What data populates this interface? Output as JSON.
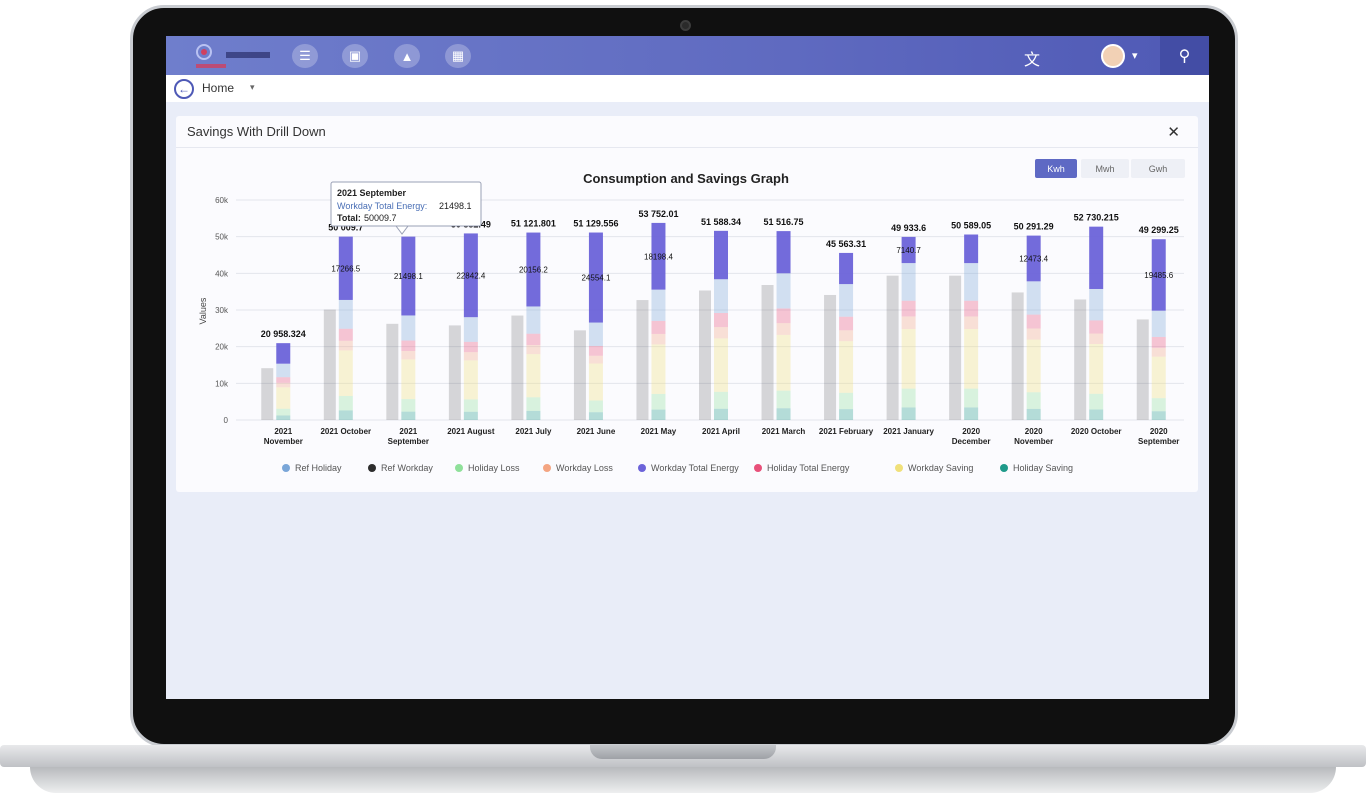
{
  "header": {
    "home_label": "Home"
  },
  "panel": {
    "title": "Savings With Drill Down",
    "close": "✕"
  },
  "units": {
    "kwh": "Kwh",
    "mwh": "Mwh",
    "gwh": "Gwh"
  },
  "icons": {
    "menu": "☰",
    "building": "▣",
    "bell": "▲",
    "grid": "▦",
    "translate": "文",
    "search": "⚲",
    "back": "←",
    "caret": "▾"
  },
  "colors": {
    "accent": "#5e69c4",
    "ref_holiday": "#7aa6d8",
    "ref_workday": "#2d2d2d",
    "holiday_loss": "#8fe09a",
    "workday_loss": "#f4a582",
    "workday_total_energy": "#6c63d9",
    "holiday_total_energy": "#e8507a",
    "workday_saving": "#f0e07a",
    "holiday_saving": "#1f9a8a"
  },
  "tooltip": {
    "title": "2021 September",
    "series_label": "Workday Total Energy:",
    "series_value": "21498.1",
    "total_label": "Total:",
    "total_value": "50009.7"
  },
  "chart_data": {
    "type": "bar",
    "title": "Consumption and Savings Graph",
    "ylabel": "Values",
    "ylim": [
      0,
      60000
    ],
    "yticks": [
      "0",
      "10k",
      "20k",
      "30k",
      "40k",
      "50k",
      "60k"
    ],
    "categories": [
      [
        "2021",
        "November"
      ],
      [
        "2021 October"
      ],
      [
        "2021",
        "September"
      ],
      [
        "2021 August"
      ],
      [
        "2021 July"
      ],
      [
        "2021 June"
      ],
      [
        "2021 May"
      ],
      [
        "2021 April"
      ],
      [
        "2021 March"
      ],
      [
        "2021 February"
      ],
      [
        "2021 January"
      ],
      [
        "2020",
        "December"
      ],
      [
        "2020",
        "November"
      ],
      [
        "2020 October"
      ],
      [
        "2020",
        "September"
      ]
    ],
    "totals": [
      20958.324,
      50009.7,
      50009.7,
      50882.49,
      51121.801,
      51129.556,
      53752.01,
      51588.34,
      51516.75,
      45563.31,
      49933.6,
      50589.05,
      50291.29,
      52730.215,
      49299.25
    ],
    "total_labels": [
      "20 958.324",
      "50 009.7",
      "",
      "50 882.49",
      "51 121.801",
      "51 129.556",
      "53 752.01",
      "51 588.34",
      "51 516.75",
      "45 563.31",
      "49 933.6",
      "50 589.05",
      "50 291.29",
      "52 730.215",
      "49 299.25"
    ],
    "workday_total_energy": [
      5600,
      17266.5,
      21498.1,
      22842.4,
      20156.2,
      24554.1,
      18198.4,
      13200,
      11500,
      8500,
      7140.7,
      7800,
      12473.4,
      17000,
      19485.6
    ],
    "workday_total_labels": [
      "",
      "17266.5",
      "21498.1",
      "22842.4",
      "20156.2",
      "24554.1",
      "18198.4",
      "",
      "",
      "",
      "7140.7",
      "",
      "12473.4",
      "",
      "19485.6"
    ],
    "legend": [
      {
        "name": "Ref Holiday",
        "key": "ref_holiday"
      },
      {
        "name": "Ref Workday",
        "key": "ref_workday"
      },
      {
        "name": "Holiday Loss",
        "key": "holiday_loss"
      },
      {
        "name": "Workday Loss",
        "key": "workday_loss"
      },
      {
        "name": "Workday Total Energy",
        "key": "workday_total_energy"
      },
      {
        "name": "Holiday Total Energy",
        "key": "holiday_total_energy"
      },
      {
        "name": "Workday Saving",
        "key": "workday_saving"
      },
      {
        "name": "Holiday Saving",
        "key": "holiday_saving"
      }
    ],
    "grid": true,
    "legend_position": "bottom"
  }
}
